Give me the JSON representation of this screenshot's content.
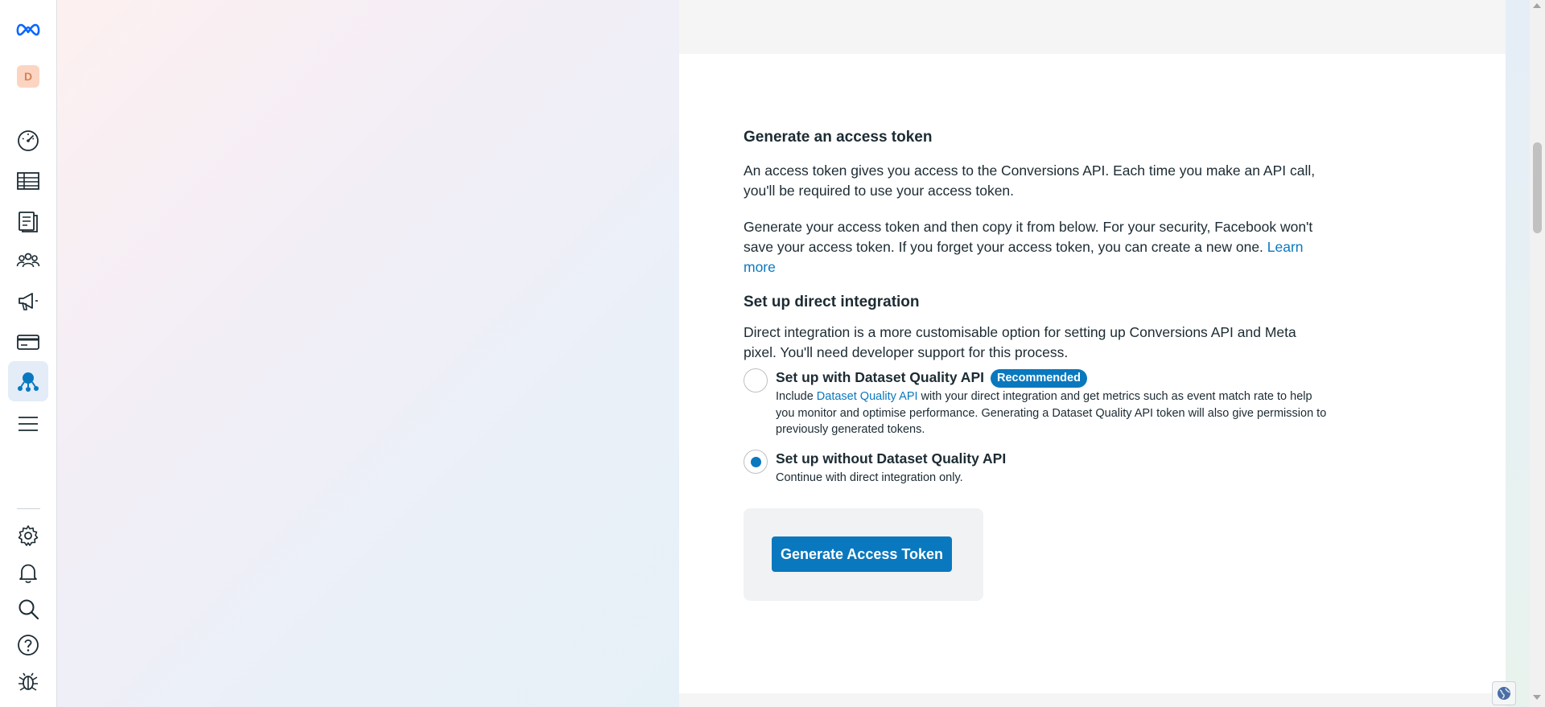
{
  "nav": {
    "avatar_initial": "D",
    "items": [
      {
        "icon": "meta-logo-icon"
      },
      {
        "icon": "dashboard-gauge-icon"
      },
      {
        "icon": "table-grid-icon"
      },
      {
        "icon": "catalog-icon"
      },
      {
        "icon": "audiences-icon"
      },
      {
        "icon": "megaphone-icon"
      },
      {
        "icon": "credit-card-icon"
      },
      {
        "icon": "data-sources-icon",
        "active": true
      },
      {
        "icon": "menu-icon"
      },
      {
        "icon": "settings-gear-icon"
      },
      {
        "icon": "bell-icon"
      },
      {
        "icon": "search-icon"
      },
      {
        "icon": "help-icon"
      },
      {
        "icon": "bug-icon"
      }
    ]
  },
  "section": {
    "title": "Generate an access token",
    "para1": "An access token gives you access to the Conversions API. Each time you make an API call, you'll be required to use your access token.",
    "para2": "Generate your access token and then copy it from below. For your security, Facebook won't save your access token. If you forget your access token, you can create a new one. ",
    "learn_more": "Learn more"
  },
  "integration": {
    "title": "Set up direct integration",
    "description": "Direct integration is a more customisable option for setting up Conversions API and Meta pixel. You'll need developer support for this process.",
    "options": [
      {
        "title": "Set up with Dataset Quality API",
        "badge": "Recommended",
        "desc_prefix": "Include ",
        "desc_link": "Dataset Quality API",
        "desc_suffix": " with your direct integration and get metrics such as event match rate to help you monitor and optimise performance. Generating a Dataset Quality API token will also give permission to previously generated tokens.",
        "selected": false
      },
      {
        "title": "Set up without Dataset Quality API",
        "desc": "Continue with direct integration only.",
        "selected": true
      }
    ]
  },
  "actions": {
    "generate_label": "Generate Access Token"
  },
  "colors": {
    "accent": "#0a78be",
    "text": "#1c2b33",
    "card_bg": "#f1f2f4"
  }
}
